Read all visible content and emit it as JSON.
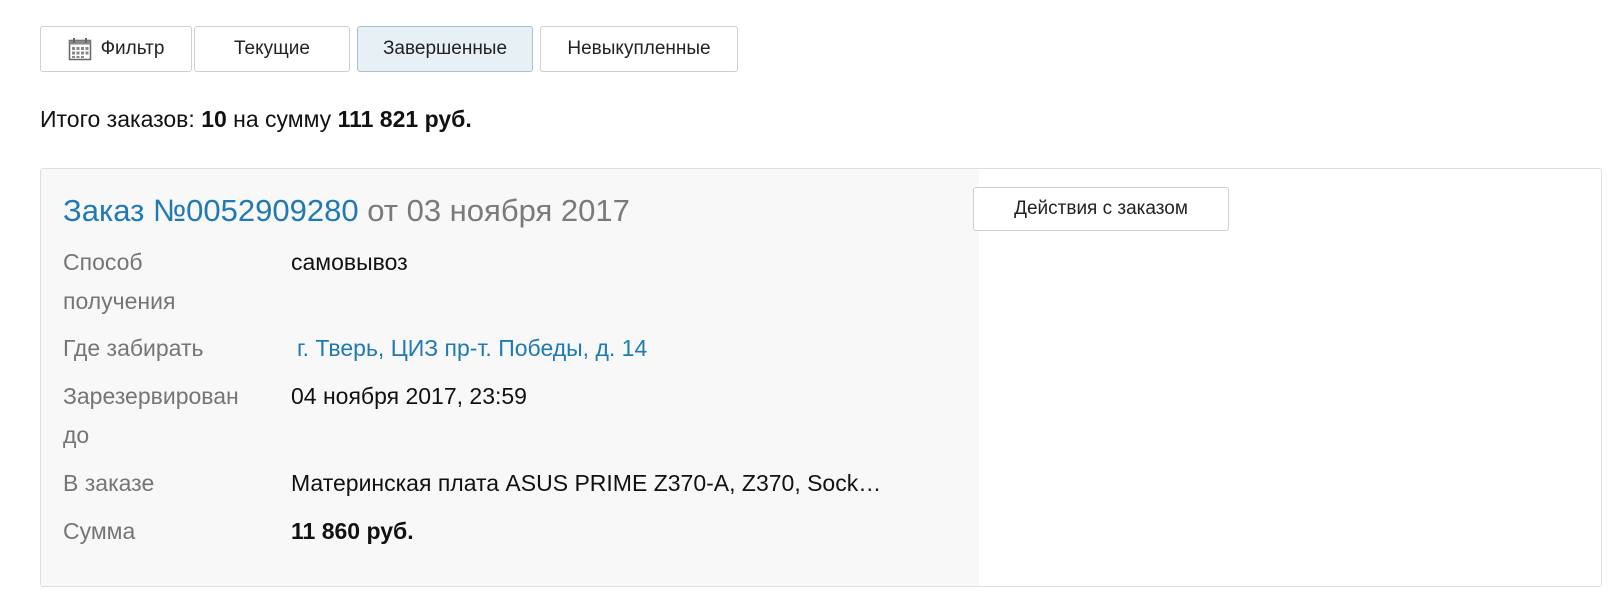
{
  "tabs": {
    "filter": {
      "label": "Фильтр",
      "icon": "calendar-icon"
    },
    "current": {
      "label": "Текущие"
    },
    "completed": {
      "label": "Завершенные",
      "active": true
    },
    "unbought": {
      "label": "Невыкупленные"
    }
  },
  "summary": {
    "prefix": "Итого заказов:",
    "count": "10",
    "middle": "на сумму",
    "total": "111 821 руб."
  },
  "order": {
    "title_link": "Заказ №0052909280",
    "title_date": "от 03 ноября 2017",
    "actions_label": "Действия с заказом",
    "fields": {
      "delivery_label_1": "Способ",
      "delivery_label_2": "получения",
      "delivery_value": "самовывоз",
      "pickup_label": "Где забирать",
      "pickup_value": "г. Тверь, ЦИЗ пр-т. Победы, д. 14",
      "reserved_label_1": "Зарезервирован",
      "reserved_label_2": "до",
      "reserved_value": "04 ноября 2017, 23:59",
      "items_label": "В заказе",
      "items_value": "Материнская плата ASUS PRIME Z370-A, Z370, Sock…",
      "sum_label": "Сумма",
      "sum_value": "11 860 руб."
    }
  },
  "colors": {
    "link": "#1f7ab4",
    "muted": "#757575",
    "active_tab_bg": "#e6f0f5",
    "card_left_bg": "#f8f8f8"
  }
}
